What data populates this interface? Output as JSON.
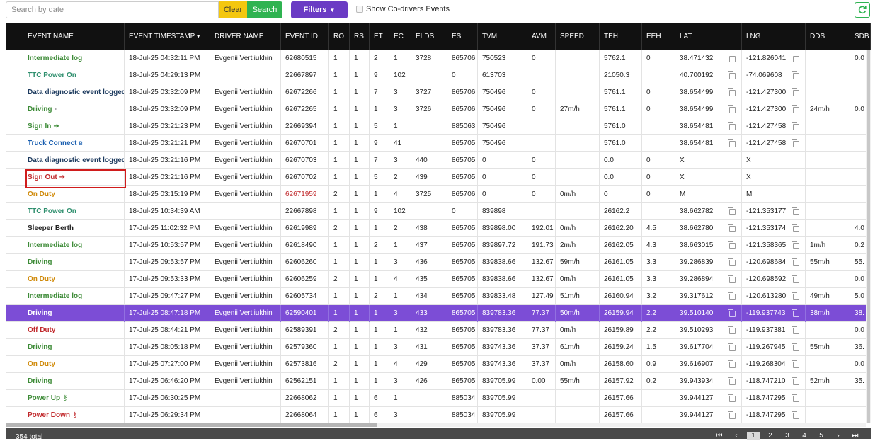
{
  "toolbar": {
    "search_placeholder": "Search by date",
    "clear_label": "Clear",
    "search_label": "Search",
    "filters_label": "Filters",
    "codrivers_label": "Show Co-drivers Events"
  },
  "columns": [
    "EVENT NAME",
    "EVENT TIMESTAMP",
    "DRIVER NAME",
    "EVENT ID",
    "RO",
    "RS",
    "ET",
    "EC",
    "ELDS",
    "ES",
    "TVM",
    "AVM",
    "SPEED",
    "TEH",
    "EEH",
    "LAT",
    "LNG",
    "DDS",
    "SDB"
  ],
  "rows": [
    {
      "name": "Intermediate log",
      "color": "green",
      "icon": "",
      "ts": "18-Jul-25 04:32:11 PM",
      "driver": "Evgenii Vertliukhin",
      "id": "62680515",
      "ro": "1",
      "rs": "1",
      "et": "2",
      "ec": "1",
      "elds": "3728",
      "es": "865706",
      "tvm": "750523",
      "avm": "0",
      "speed": "",
      "teh": "5762.1",
      "eeh": "0",
      "lat": "38.471432",
      "latc": true,
      "lng": "-121.826041",
      "lngc": true,
      "dds": "",
      "sdb": "0.0"
    },
    {
      "name": "TTC Power On",
      "color": "teal",
      "icon": "",
      "ts": "18-Jul-25 04:29:13 PM",
      "driver": "",
      "id": "22667897",
      "ro": "1",
      "rs": "1",
      "et": "9",
      "ec": "102",
      "elds": "",
      "es": "0",
      "tvm": "613703",
      "avm": "",
      "speed": "",
      "teh": "21050.3",
      "eeh": "",
      "lat": "40.700192",
      "latc": true,
      "lng": "-74.069608",
      "lngc": true,
      "dds": "",
      "sdb": ""
    },
    {
      "name": "Data diagnostic event logged",
      "color": "navy",
      "icon": "",
      "ts": "18-Jul-25 03:32:09 PM",
      "driver": "Evgenii Vertliukhin",
      "id": "62672266",
      "ro": "1",
      "rs": "1",
      "et": "7",
      "ec": "3",
      "elds": "3727",
      "es": "865706",
      "tvm": "750496",
      "avm": "0",
      "speed": "",
      "teh": "5761.1",
      "eeh": "0",
      "lat": "38.654499",
      "latc": true,
      "lng": "-121.427300",
      "lngc": true,
      "dds": "",
      "sdb": ""
    },
    {
      "name": "Driving",
      "color": "green",
      "icon": "cam",
      "ts": "18-Jul-25 03:32:09 PM",
      "driver": "Evgenii Vertliukhin",
      "id": "62672265",
      "ro": "1",
      "rs": "1",
      "et": "1",
      "ec": "3",
      "elds": "3726",
      "es": "865706",
      "tvm": "750496",
      "avm": "0",
      "speed": "27m/h",
      "teh": "5761.1",
      "eeh": "0",
      "lat": "38.654499",
      "latc": true,
      "lng": "-121.427300",
      "lngc": true,
      "dds": "24m/h",
      "sdb": "0.0"
    },
    {
      "name": "Sign In",
      "color": "green",
      "icon": "signin",
      "ts": "18-Jul-25 03:21:23 PM",
      "driver": "Evgenii Vertliukhin",
      "id": "22669394",
      "ro": "1",
      "rs": "1",
      "et": "5",
      "ec": "1",
      "elds": "",
      "es": "885063",
      "tvm": "750496",
      "avm": "",
      "speed": "",
      "teh": "5761.0",
      "eeh": "",
      "lat": "38.654481",
      "latc": true,
      "lng": "-121.427458",
      "lngc": true,
      "dds": "",
      "sdb": ""
    },
    {
      "name": "Truck Connect",
      "color": "blue",
      "icon": "bt",
      "ts": "18-Jul-25 03:21:21 PM",
      "driver": "Evgenii Vertliukhin",
      "id": "62670701",
      "ro": "1",
      "rs": "1",
      "et": "9",
      "ec": "41",
      "elds": "",
      "es": "865705",
      "tvm": "750496",
      "avm": "",
      "speed": "",
      "teh": "5761.0",
      "eeh": "",
      "lat": "38.654481",
      "latc": true,
      "lng": "-121.427458",
      "lngc": true,
      "dds": "",
      "sdb": ""
    },
    {
      "name": "Data diagnostic event logged",
      "color": "navy",
      "icon": "",
      "ts": "18-Jul-25 03:21:16 PM",
      "driver": "Evgenii Vertliukhin",
      "id": "62670703",
      "ro": "1",
      "rs": "1",
      "et": "7",
      "ec": "3",
      "elds": "440",
      "es": "865705",
      "tvm": "0",
      "avm": "0",
      "speed": "",
      "teh": "0.0",
      "eeh": "0",
      "lat": "X",
      "latc": false,
      "lng": "X",
      "lngc": false,
      "dds": "",
      "sdb": ""
    },
    {
      "name": "Sign Out",
      "color": "red",
      "icon": "signout",
      "ts": "18-Jul-25 03:21:16 PM",
      "driver": "Evgenii Vertliukhin",
      "id": "62670702",
      "ro": "1",
      "rs": "1",
      "et": "5",
      "ec": "2",
      "elds": "439",
      "es": "865705",
      "tvm": "0",
      "avm": "0",
      "speed": "",
      "teh": "0.0",
      "eeh": "0",
      "lat": "X",
      "latc": false,
      "lng": "X",
      "lngc": false,
      "dds": "",
      "sdb": ""
    },
    {
      "name": "On Duty",
      "color": "orange",
      "icon": "",
      "ts": "18-Jul-25 03:15:19 PM",
      "driver": "Evgenii Vertliukhin",
      "id": "62671959",
      "idred": true,
      "ro": "2",
      "rs": "1",
      "et": "1",
      "ec": "4",
      "elds": "3725",
      "es": "865706",
      "tvm": "0",
      "avm": "0",
      "speed": "0m/h",
      "teh": "0",
      "eeh": "0",
      "lat": "M",
      "latc": false,
      "lng": "M",
      "lngc": false,
      "dds": "",
      "sdb": ""
    },
    {
      "name": "TTC Power On",
      "color": "teal",
      "icon": "",
      "ts": "18-Jul-25 10:34:39 AM",
      "driver": "",
      "id": "22667898",
      "ro": "1",
      "rs": "1",
      "et": "9",
      "ec": "102",
      "elds": "",
      "es": "0",
      "tvm": "839898",
      "avm": "",
      "speed": "",
      "teh": "26162.2",
      "eeh": "",
      "lat": "38.662782",
      "latc": true,
      "lng": "-121.353177",
      "lngc": true,
      "dds": "",
      "sdb": ""
    },
    {
      "name": "Sleeper Berth",
      "color": "black",
      "icon": "",
      "ts": "17-Jul-25 11:02:32 PM",
      "driver": "Evgenii Vertliukhin",
      "id": "62619989",
      "ro": "2",
      "rs": "1",
      "et": "1",
      "ec": "2",
      "elds": "438",
      "es": "865705",
      "tvm": "839898.00",
      "avm": "192.01",
      "speed": "0m/h",
      "teh": "26162.20",
      "eeh": "4.5",
      "lat": "38.662780",
      "latc": true,
      "lng": "-121.353174",
      "lngc": true,
      "dds": "",
      "sdb": "4.0"
    },
    {
      "name": "Intermediate log",
      "color": "green",
      "icon": "",
      "ts": "17-Jul-25 10:53:57 PM",
      "driver": "Evgenii Vertliukhin",
      "id": "62618490",
      "ro": "1",
      "rs": "1",
      "et": "2",
      "ec": "1",
      "elds": "437",
      "es": "865705",
      "tvm": "839897.72",
      "avm": "191.73",
      "speed": "2m/h",
      "teh": "26162.05",
      "eeh": "4.3",
      "lat": "38.663015",
      "latc": true,
      "lng": "-121.358365",
      "lngc": true,
      "dds": "1m/h",
      "sdb": "0.2"
    },
    {
      "name": "Driving",
      "color": "green",
      "icon": "",
      "ts": "17-Jul-25 09:53:57 PM",
      "driver": "Evgenii Vertliukhin",
      "id": "62606260",
      "ro": "1",
      "rs": "1",
      "et": "1",
      "ec": "3",
      "elds": "436",
      "es": "865705",
      "tvm": "839838.66",
      "avm": "132.67",
      "speed": "59m/h",
      "teh": "26161.05",
      "eeh": "3.3",
      "lat": "39.286839",
      "latc": true,
      "lng": "-120.698684",
      "lngc": true,
      "dds": "55m/h",
      "sdb": "55."
    },
    {
      "name": "On Duty",
      "color": "orange",
      "icon": "",
      "ts": "17-Jul-25 09:53:33 PM",
      "driver": "Evgenii Vertliukhin",
      "id": "62606259",
      "ro": "2",
      "rs": "1",
      "et": "1",
      "ec": "4",
      "elds": "435",
      "es": "865705",
      "tvm": "839838.66",
      "avm": "132.67",
      "speed": "0m/h",
      "teh": "26161.05",
      "eeh": "3.3",
      "lat": "39.286894",
      "latc": true,
      "lng": "-120.698592",
      "lngc": true,
      "dds": "",
      "sdb": "0.0"
    },
    {
      "name": "Intermediate log",
      "color": "green",
      "icon": "",
      "ts": "17-Jul-25 09:47:27 PM",
      "driver": "Evgenii Vertliukhin",
      "id": "62605734",
      "ro": "1",
      "rs": "1",
      "et": "2",
      "ec": "1",
      "elds": "434",
      "es": "865705",
      "tvm": "839833.48",
      "avm": "127.49",
      "speed": "51m/h",
      "teh": "26160.94",
      "eeh": "3.2",
      "lat": "39.317612",
      "latc": true,
      "lng": "-120.613280",
      "lngc": true,
      "dds": "49m/h",
      "sdb": "5.0"
    },
    {
      "name": "Driving",
      "color": "green",
      "icon": "",
      "sel": true,
      "ts": "17-Jul-25 08:47:18 PM",
      "driver": "Evgenii Vertliukhin",
      "id": "62590401",
      "ro": "1",
      "rs": "1",
      "et": "1",
      "ec": "3",
      "elds": "433",
      "es": "865705",
      "tvm": "839783.36",
      "avm": "77.37",
      "speed": "50m/h",
      "teh": "26159.94",
      "eeh": "2.2",
      "lat": "39.510140",
      "latc": true,
      "lng": "-119.937743",
      "lngc": true,
      "dds": "38m/h",
      "sdb": "38."
    },
    {
      "name": "Off Duty",
      "color": "red",
      "icon": "",
      "ts": "17-Jul-25 08:44:21 PM",
      "driver": "Evgenii Vertliukhin",
      "id": "62589391",
      "ro": "2",
      "rs": "1",
      "et": "1",
      "ec": "1",
      "elds": "432",
      "es": "865705",
      "tvm": "839783.36",
      "avm": "77.37",
      "speed": "0m/h",
      "teh": "26159.89",
      "eeh": "2.2",
      "lat": "39.510293",
      "latc": true,
      "lng": "-119.937381",
      "lngc": true,
      "dds": "",
      "sdb": "0.0"
    },
    {
      "name": "Driving",
      "color": "green",
      "icon": "",
      "ts": "17-Jul-25 08:05:18 PM",
      "driver": "Evgenii Vertliukhin",
      "id": "62579360",
      "ro": "1",
      "rs": "1",
      "et": "1",
      "ec": "3",
      "elds": "431",
      "es": "865705",
      "tvm": "839743.36",
      "avm": "37.37",
      "speed": "61m/h",
      "teh": "26159.24",
      "eeh": "1.5",
      "lat": "39.617704",
      "latc": true,
      "lng": "-119.267945",
      "lngc": true,
      "dds": "55m/h",
      "sdb": "36."
    },
    {
      "name": "On Duty",
      "color": "orange",
      "icon": "",
      "ts": "17-Jul-25 07:27:00 PM",
      "driver": "Evgenii Vertliukhin",
      "id": "62573816",
      "ro": "2",
      "rs": "1",
      "et": "1",
      "ec": "4",
      "elds": "429",
      "es": "865705",
      "tvm": "839743.36",
      "avm": "37.37",
      "speed": "0m/h",
      "teh": "26158.60",
      "eeh": "0.9",
      "lat": "39.616907",
      "latc": true,
      "lng": "-119.268304",
      "lngc": true,
      "dds": "",
      "sdb": "0.0"
    },
    {
      "name": "Driving",
      "color": "green",
      "icon": "",
      "ts": "17-Jul-25 06:46:20 PM",
      "driver": "Evgenii Vertliukhin",
      "id": "62562151",
      "ro": "1",
      "rs": "1",
      "et": "1",
      "ec": "3",
      "elds": "426",
      "es": "865705",
      "tvm": "839705.99",
      "avm": "0.00",
      "speed": "55m/h",
      "teh": "26157.92",
      "eeh": "0.2",
      "lat": "39.943934",
      "latc": true,
      "lng": "-118.747210",
      "lngc": true,
      "dds": "52m/h",
      "sdb": "35."
    },
    {
      "name": "Power Up",
      "color": "green",
      "icon": "key",
      "ts": "17-Jul-25 06:30:25 PM",
      "driver": "",
      "id": "22668062",
      "ro": "1",
      "rs": "1",
      "et": "6",
      "ec": "1",
      "elds": "",
      "es": "885034",
      "tvm": "839705.99",
      "avm": "",
      "speed": "",
      "teh": "26157.66",
      "eeh": "",
      "lat": "39.944127",
      "latc": true,
      "lng": "-118.747295",
      "lngc": true,
      "dds": "",
      "sdb": ""
    },
    {
      "name": "Power Down",
      "color": "red",
      "icon": "key",
      "ts": "17-Jul-25 06:29:34 PM",
      "driver": "",
      "id": "22668064",
      "ro": "1",
      "rs": "1",
      "et": "6",
      "ec": "3",
      "elds": "",
      "es": "885034",
      "tvm": "839705.99",
      "avm": "",
      "speed": "",
      "teh": "26157.66",
      "eeh": "",
      "lat": "39.944127",
      "latc": true,
      "lng": "-118.747295",
      "lngc": true,
      "dds": "",
      "sdb": ""
    }
  ],
  "footer": {
    "total": "354 total",
    "pages": [
      "1",
      "2",
      "3",
      "4",
      "5"
    ]
  },
  "colors": {
    "accent": "#6a3bc4",
    "selected": "#7c4dd6",
    "clear": "#f4c70f",
    "search": "#2fb351"
  }
}
